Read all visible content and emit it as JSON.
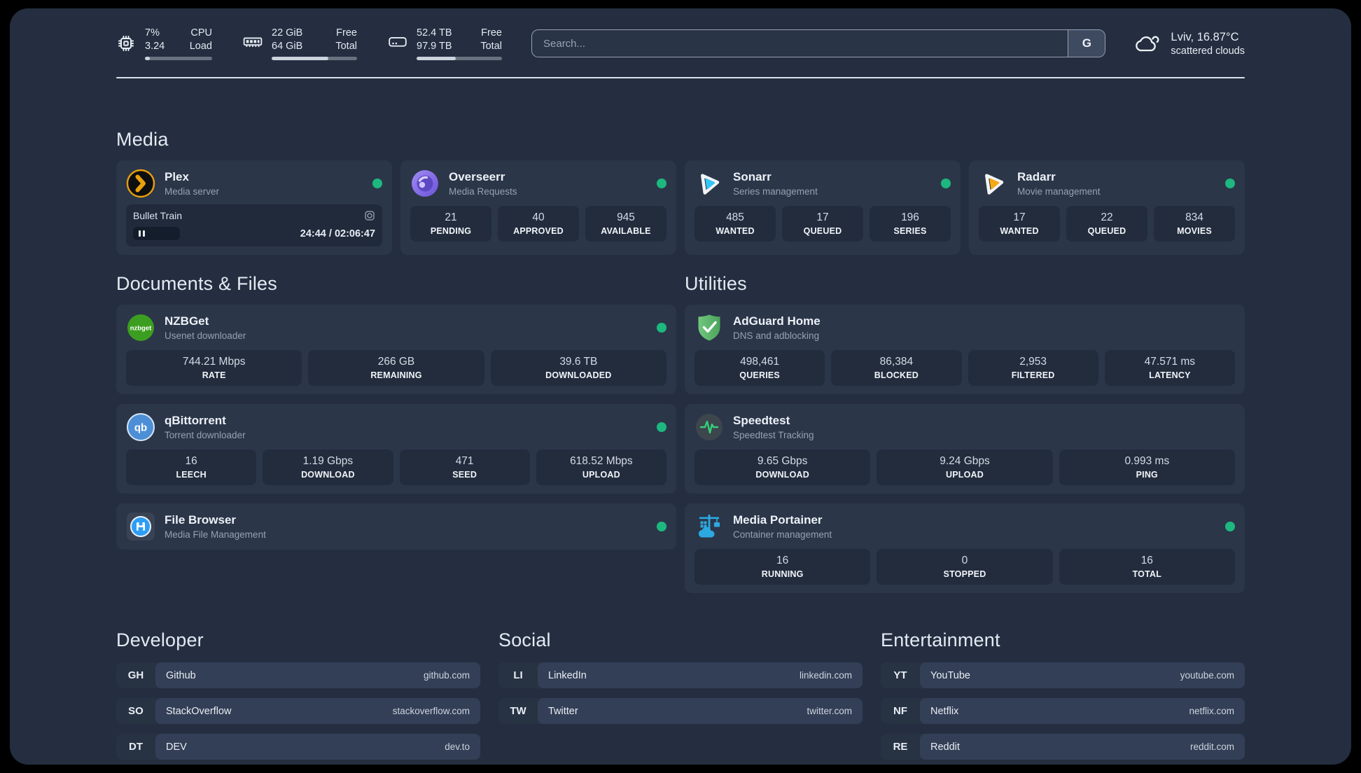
{
  "topbar": {
    "cpu": {
      "percent": 7,
      "value_top": "7%",
      "value_bottom": "3.24",
      "label_top": "CPU",
      "label_bottom": "Load"
    },
    "memory": {
      "percent": 66,
      "value_top": "22 GiB",
      "value_bottom": "64 GiB",
      "label_top": "Free",
      "label_bottom": "Total"
    },
    "disk": {
      "percent": 46,
      "value_top": "52.4 TB",
      "value_bottom": "97.9 TB",
      "label_top": "Free",
      "label_bottom": "Total"
    },
    "search": {
      "placeholder": "Search...",
      "button_label": "G"
    },
    "weather": {
      "location_temp": "Lviv, 16.87°C",
      "condition": "scattered clouds"
    }
  },
  "media": {
    "heading": "Media",
    "plex": {
      "name": "Plex",
      "subtitle": "Media server",
      "session": {
        "title": "Bullet Train",
        "progress_percent": 19.5,
        "time": "24:44 / 02:06:47"
      }
    },
    "overseerr": {
      "name": "Overseerr",
      "subtitle": "Media Requests",
      "stats": [
        {
          "value": "21",
          "label": "PENDING"
        },
        {
          "value": "40",
          "label": "APPROVED"
        },
        {
          "value": "945",
          "label": "AVAILABLE"
        }
      ]
    },
    "sonarr": {
      "name": "Sonarr",
      "subtitle": "Series management",
      "stats": [
        {
          "value": "485",
          "label": "WANTED"
        },
        {
          "value": "17",
          "label": "QUEUED"
        },
        {
          "value": "196",
          "label": "SERIES"
        }
      ]
    },
    "radarr": {
      "name": "Radarr",
      "subtitle": "Movie management",
      "stats": [
        {
          "value": "17",
          "label": "WANTED"
        },
        {
          "value": "22",
          "label": "QUEUED"
        },
        {
          "value": "834",
          "label": "MOVIES"
        }
      ]
    }
  },
  "documents": {
    "heading": "Documents & Files",
    "nzbget": {
      "name": "NZBGet",
      "subtitle": "Usenet downloader",
      "stats": [
        {
          "value": "744.21 Mbps",
          "label": "RATE"
        },
        {
          "value": "266 GB",
          "label": "REMAINING"
        },
        {
          "value": "39.6 TB",
          "label": "DOWNLOADED"
        }
      ]
    },
    "qbittorrent": {
      "name": "qBittorrent",
      "subtitle": "Torrent downloader",
      "stats": [
        {
          "value": "16",
          "label": "LEECH"
        },
        {
          "value": "1.19 Gbps",
          "label": "DOWNLOAD"
        },
        {
          "value": "471",
          "label": "SEED"
        },
        {
          "value": "618.52 Mbps",
          "label": "UPLOAD"
        }
      ]
    },
    "filebrowser": {
      "name": "File Browser",
      "subtitle": "Media File Management"
    }
  },
  "utilities": {
    "heading": "Utilities",
    "adguard": {
      "name": "AdGuard Home",
      "subtitle": "DNS and adblocking",
      "stats": [
        {
          "value": "498,461",
          "label": "QUERIES"
        },
        {
          "value": "86,384",
          "label": "BLOCKED"
        },
        {
          "value": "2,953",
          "label": "FILTERED"
        },
        {
          "value": "47.571 ms",
          "label": "LATENCY"
        }
      ]
    },
    "speedtest": {
      "name": "Speedtest",
      "subtitle": "Speedtest Tracking",
      "stats": [
        {
          "value": "9.65 Gbps",
          "label": "DOWNLOAD"
        },
        {
          "value": "9.24 Gbps",
          "label": "UPLOAD"
        },
        {
          "value": "0.993 ms",
          "label": "PING"
        }
      ]
    },
    "portainer": {
      "name": "Media Portainer",
      "subtitle": "Container management",
      "stats": [
        {
          "value": "16",
          "label": "RUNNING"
        },
        {
          "value": "0",
          "label": "STOPPED"
        },
        {
          "value": "16",
          "label": "TOTAL"
        }
      ]
    }
  },
  "links": {
    "developer": {
      "heading": "Developer",
      "items": [
        {
          "abbr": "GH",
          "name": "Github",
          "url": "github.com"
        },
        {
          "abbr": "SO",
          "name": "StackOverflow",
          "url": "stackoverflow.com"
        },
        {
          "abbr": "DT",
          "name": "DEV",
          "url": "dev.to"
        }
      ]
    },
    "social": {
      "heading": "Social",
      "items": [
        {
          "abbr": "LI",
          "name": "LinkedIn",
          "url": "linkedin.com"
        },
        {
          "abbr": "TW",
          "name": "Twitter",
          "url": "twitter.com"
        }
      ]
    },
    "entertainment": {
      "heading": "Entertainment",
      "items": [
        {
          "abbr": "YT",
          "name": "YouTube",
          "url": "youtube.com"
        },
        {
          "abbr": "NF",
          "name": "Netflix",
          "url": "netflix.com"
        },
        {
          "abbr": "RE",
          "name": "Reddit",
          "url": "reddit.com"
        }
      ]
    }
  },
  "colors": {
    "status_online": "#1db87f",
    "plex_gold": "#e8a00c",
    "overseerr_purple": "#8b72ee",
    "sonarr_blue": "#35c5f4",
    "radarr_gold": "#f5a915",
    "nzbget_green": "#3c9e20",
    "qbittorrent_blue": "#4d8fd6",
    "filebrowser_blue": "#2e9df5",
    "adguard_green": "#5cb768",
    "speedtest_green": "#35d07c",
    "portainer_blue": "#2ca9e1"
  },
  "icons": [
    "cpu-chip-icon",
    "ram-icon",
    "disk-icon",
    "cloud-icon",
    "pause-icon",
    "session-target-icon"
  ]
}
